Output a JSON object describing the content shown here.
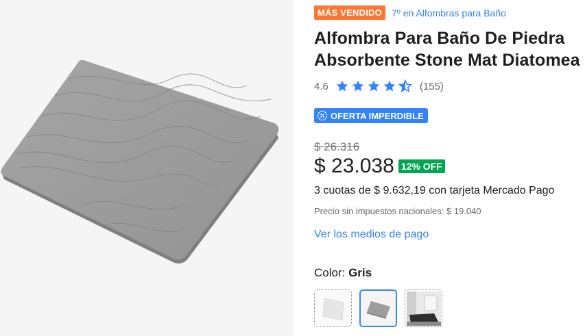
{
  "product": {
    "best_seller_badge": "MÁS VENDIDO",
    "ranking_link": "7º en Alfombras para Baño",
    "title_line1": "Alfombra Para Baño De Piedra",
    "title_line2": "Absorbente Stone Mat Diatomea",
    "rating_value": "4.6",
    "rating_stars": 4.6,
    "reviews_count": "(155)",
    "deal_badge": "OFERTA IMPERDIBLE",
    "original_price": "$ 26.316",
    "price": "$ 23.038",
    "discount": "12% OFF",
    "installments": "3 cuotas de $ 9.632,19 con tarjeta Mercado Pago",
    "tax_note": "Precio sin impuestos nacionales: $ 19.040",
    "payment_methods_link": "Ver los medios de pago",
    "color_label": "Color: ",
    "color_value": "Gris",
    "color_options": [
      "Blanco",
      "Gris",
      "Ambiente"
    ],
    "selected_color_index": 1
  },
  "icons": {
    "star": "star-icon",
    "half_star": "half-star-icon",
    "deal": "deal-icon"
  },
  "colors": {
    "accent_blue": "#3483fa",
    "best_seller_orange": "#ff7733",
    "discount_green": "#00a650",
    "mat_gray": "#9a9a9a"
  }
}
